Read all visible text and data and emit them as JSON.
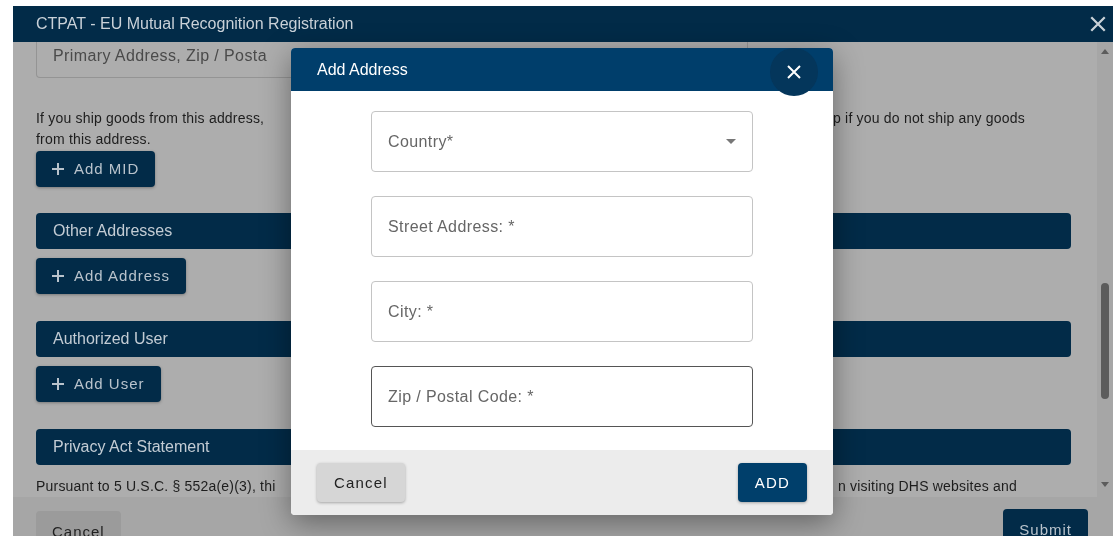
{
  "window": {
    "title": "CTPAT - EU Mutual Recognition Registration"
  },
  "background": {
    "address_field_value": "Primary Address, Zip / Posta",
    "mid_note": {
      "left_lines": [
        "If you ship goods from this address,",
        "from this address."
      ],
      "right_line": "p if you do not ship any goods"
    },
    "add_mid_button": "Add MID",
    "sections": [
      {
        "title": "Other Addresses",
        "button": "Add Address"
      },
      {
        "title": "Authorized User",
        "button": "Add User"
      },
      {
        "title": "Privacy Act Statement",
        "text_left": "Pursuant to 5 U.S.C. § 552a(e)(3), thi",
        "text_right": "n visiting DHS websites and"
      }
    ],
    "footer": {
      "cancel": "Cancel",
      "submit": "Submit"
    }
  },
  "dialog": {
    "title": "Add Address",
    "fields": [
      {
        "kind": "select",
        "placeholder": "Country*",
        "hovered": false
      },
      {
        "kind": "text",
        "placeholder": "Street Address: *",
        "hovered": false
      },
      {
        "kind": "text",
        "placeholder": "City: *",
        "hovered": false
      },
      {
        "kind": "text",
        "placeholder": "Zip / Postal Code: *",
        "hovered": true
      }
    ],
    "cancel": "Cancel",
    "add": "ADD"
  }
}
